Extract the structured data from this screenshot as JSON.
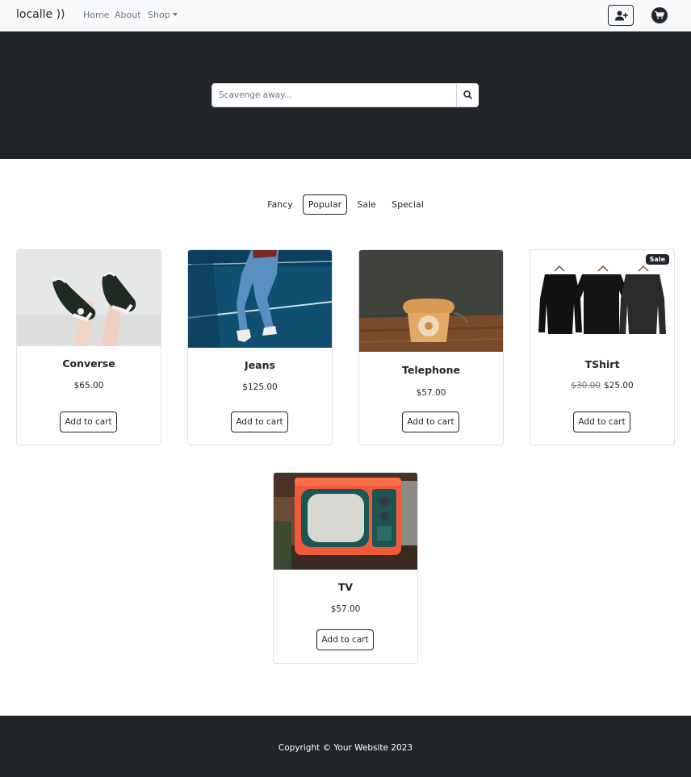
{
  "navbar": {
    "brand": "localle ))",
    "links": {
      "home": "Home",
      "about": "About",
      "shop": "Shop"
    },
    "icons": {
      "user": "user-plus-icon",
      "cart": "cart-icon"
    }
  },
  "hero": {
    "search": {
      "placeholder": "Scavenge away...",
      "value": "",
      "icon": "search-icon"
    }
  },
  "tabs": [
    "Fancy",
    "Popular",
    "Sale",
    "Special"
  ],
  "active_tab": "Popular",
  "products": [
    {
      "name": "Converse",
      "price": "$65.00",
      "button": "Add to cart",
      "image": "sneakers-photo"
    },
    {
      "name": "Jeans",
      "price": "$125.00",
      "button": "Add to cart",
      "image": "jeans-photo"
    },
    {
      "name": "Telephone",
      "price": "$57.00",
      "button": "Add to cart",
      "image": "telephone-photo"
    },
    {
      "name": "TShirt",
      "old_price": "$30.00",
      "price": "$25.00",
      "badge": "Sale",
      "button": "Add to cart",
      "image": "tshirts-photo"
    },
    {
      "name": "TV",
      "price": "$57.00",
      "button": "Add to cart",
      "image": "tv-photo"
    }
  ],
  "footer": {
    "copyright": "Copyright © Your Website 2023"
  },
  "colors": {
    "dark": "#212529",
    "light": "#f8f9fa",
    "muted": "#6c757d",
    "border": "#dee2e6"
  }
}
